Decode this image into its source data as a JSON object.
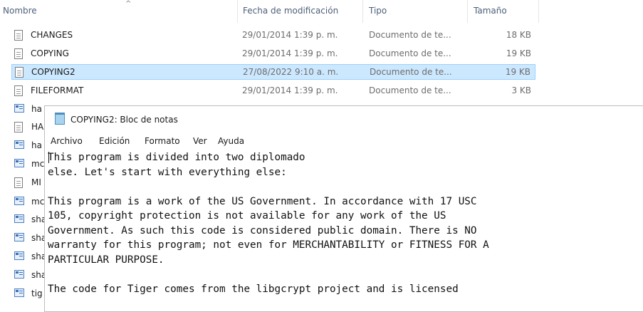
{
  "explorer": {
    "columns": {
      "name": "Nombre",
      "date": "Fecha de modificación",
      "type": "Tipo",
      "size": "Tamaño"
    },
    "files": [
      {
        "name": "CHANGES",
        "date": "29/01/2014 1:39 p. m.",
        "type": "Documento de te...",
        "size": "18 KB",
        "icon": "text-document-icon"
      },
      {
        "name": "COPYING",
        "date": "29/01/2014 1:39 p. m.",
        "type": "Documento de te...",
        "size": "19 KB",
        "icon": "text-document-icon"
      },
      {
        "name": "COPYING2",
        "date": "27/08/2022 9:10 a. m.",
        "type": "Documento de te...",
        "size": "19 KB",
        "icon": "text-document-icon",
        "selected": true
      },
      {
        "name": "FILEFORMAT",
        "date": "29/01/2014 1:39 p. m.",
        "type": "Documento de te...",
        "size": "3 KB",
        "icon": "text-document-icon"
      }
    ],
    "partial_files": [
      {
        "name": "ha",
        "icon": "application-icon"
      },
      {
        "name": "HA",
        "icon": "text-document-icon"
      },
      {
        "name": "ha",
        "icon": "application-icon"
      },
      {
        "name": "mc",
        "icon": "application-icon"
      },
      {
        "name": "MI",
        "icon": "text-document-icon"
      },
      {
        "name": "mc",
        "icon": "application-icon"
      },
      {
        "name": "sha",
        "icon": "application-icon"
      },
      {
        "name": "sha",
        "icon": "application-icon"
      },
      {
        "name": "sha",
        "icon": "application-icon"
      },
      {
        "name": "sha",
        "icon": "application-icon"
      },
      {
        "name": "tig",
        "icon": "application-icon"
      }
    ]
  },
  "notepad": {
    "title": "COPYING2: Bloc de notas",
    "menu": [
      "Archivo",
      "Edición",
      "Formato",
      "Ver",
      "Ayuda"
    ],
    "lines": [
      "This program is divided into two diplomado",
      "else. Let's start with everything else:",
      "",
      "This program is a work of the US Government. In accordance with 17 USC",
      "105, copyright protection is not available for any work of the US",
      "Government. As such this code is considered public domain. There is NO",
      "warranty for this program; not even for MERCHANTABILITY or FITNESS FOR A",
      "PARTICULAR PURPOSE.",
      "",
      "The code for Tiger comes from the libgcrypt project and is licensed"
    ]
  }
}
